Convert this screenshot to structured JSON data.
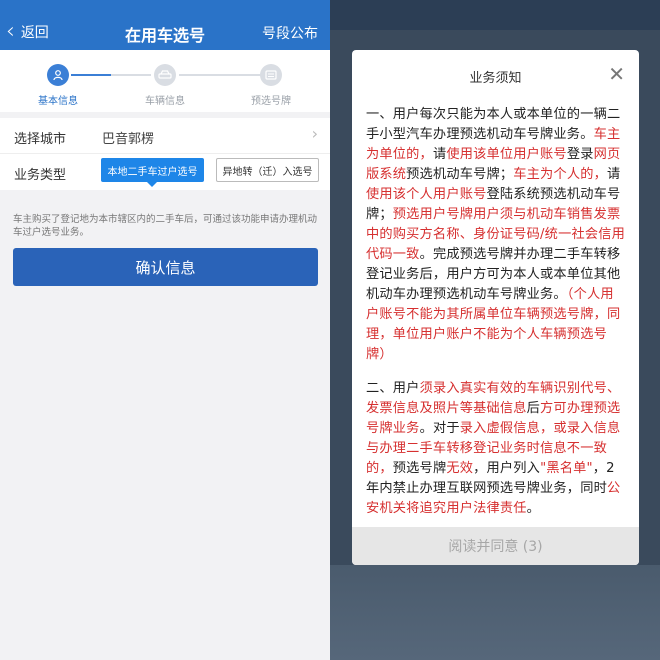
{
  "left": {
    "nav": {
      "back_label": "返回",
      "title": "在用车选号",
      "right_link": "号段公布"
    },
    "steps": [
      {
        "label": "基本信息",
        "icon": "user-icon"
      },
      {
        "label": "车辆信息",
        "icon": "car-icon"
      },
      {
        "label": "预选号牌",
        "icon": "plate-icon"
      }
    ],
    "form": {
      "city_label": "选择城市",
      "city_value": "巴音郭楞",
      "type_label": "业务类型",
      "type_options": [
        "本地二手车过户选号",
        "异地转（迁）入选号"
      ],
      "type_selected": "本地二手车过户选号"
    },
    "description": "车主购买了登记地为本市辖区内的二手车后，可通过该功能申请办理机动车过户选号业务。",
    "confirm_button": "确认信息"
  },
  "modal": {
    "title": "业务须知",
    "para1": {
      "s1": "一、用户每次只能为本人或本单位的一辆二手小型汽车办理预选机动车号牌业务。",
      "s2": "车主为单位的，",
      "s3": "请",
      "s4": "使用该单位用户账号",
      "s5": "登录",
      "s6": "网页版系统",
      "s7": "预选机动车号牌；",
      "s8": "车主为个人的，",
      "s9": "请",
      "s10": "使用该个人用户账号",
      "s11": "登陆系统预选机动车号牌；",
      "s12": "预选用户号牌用户须与机动车销售发票中的购买方名称、身份证号码/统一社会信用代码一致",
      "s13": "。完成预选号牌并办理二手车转移登记业务后，用户方可为本人或本单位其他机动车办理预选机动车号牌业务。",
      "s14": "（个人用户账号不能为其所属单位车辆预选号牌，同理，单位用户账户不能为个人车辆预选号牌）"
    },
    "para2": {
      "s1": "二、用户",
      "s2": "须录入真实有效的车辆识别代号、发票信息及照片等基础信息",
      "s3": "后",
      "s4": "方可办理预选号牌业务",
      "s5": "。对于",
      "s6": "录入虚假信息，或录入信息与办理二手车转移登记业务时信息不一致的，",
      "s7": "预选号牌",
      "s8": "无效",
      "s9": "，用户列入",
      "s10": "\"黑名单\"",
      "s11": "，2年内禁止办理互联网预选号牌业务，同时",
      "s12": "公安机关将追究用户法律责任",
      "s13": "。"
    },
    "footer_button": "阅读并同意 (3)"
  },
  "colors": {
    "brand_blue": "#2a73c8",
    "button_blue": "#2a63b8",
    "selected_option": "#1e86e8",
    "warning_red": "#d63030",
    "disabled_gray": "#e6e6e6"
  }
}
